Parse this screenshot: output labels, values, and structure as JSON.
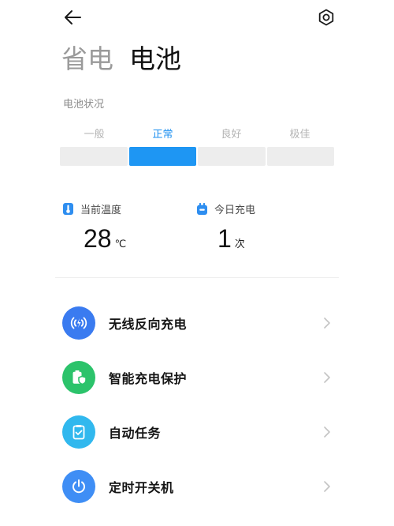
{
  "header": {
    "tabs": [
      {
        "label": "省电",
        "active": false
      },
      {
        "label": "电池",
        "active": true
      }
    ],
    "back_icon": "back-arrow-icon",
    "settings_icon": "gear-icon"
  },
  "battery_status": {
    "label": "电池状况",
    "levels": [
      "一般",
      "正常",
      "良好",
      "极佳"
    ],
    "active_index": 1,
    "active_color": "#1e96f3"
  },
  "metrics": {
    "temperature": {
      "label": "当前温度",
      "value": "28",
      "unit": "℃",
      "icon": "thermometer-icon"
    },
    "charge_count": {
      "label": "今日充电",
      "value": "1",
      "unit": "次",
      "icon": "battery-plug-icon"
    }
  },
  "menu": {
    "items": [
      {
        "label": "无线反向充电",
        "icon": "wireless-charging-icon",
        "color": "#3a7bf0"
      },
      {
        "label": "智能充电保护",
        "icon": "battery-shield-icon",
        "color": "#2cc36b"
      },
      {
        "label": "自动任务",
        "icon": "clipboard-check-icon",
        "color": "#31b8ee"
      },
      {
        "label": "定时开关机",
        "icon": "power-icon",
        "color": "#3f8ef5"
      }
    ]
  }
}
